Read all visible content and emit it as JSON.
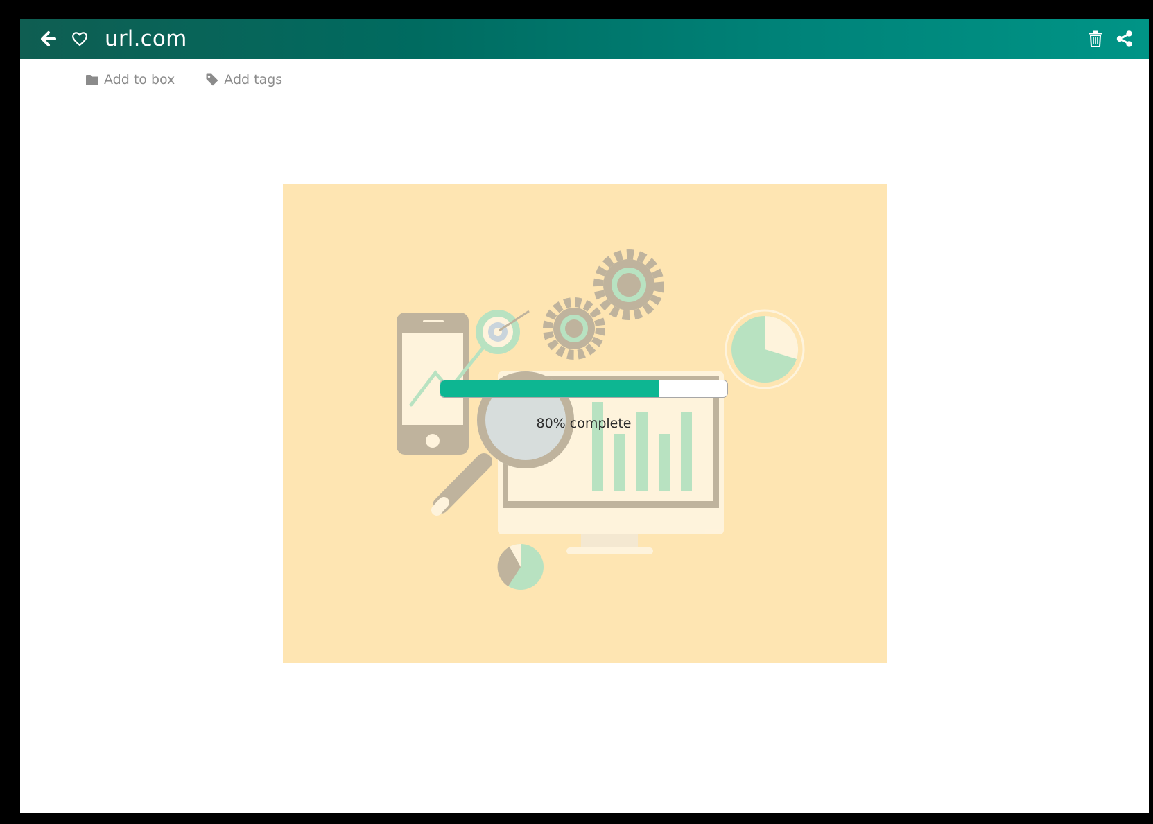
{
  "header": {
    "title": "url.com",
    "back_icon": "arrow-left-icon",
    "favorite_icon": "heart-outline-icon",
    "delete_icon": "trash-icon",
    "share_icon": "share-icon",
    "background_gradient": [
      "#0f5e52",
      "#009486"
    ]
  },
  "actions": {
    "add_to_box": {
      "label": "Add to box",
      "icon": "folder-icon"
    },
    "add_tags": {
      "label": "Add tags",
      "icon": "tag-icon"
    }
  },
  "preview": {
    "background_color": "#fee5b2",
    "illustration": "analytics-illustration"
  },
  "progress": {
    "percent": 80,
    "label": "80% complete",
    "fill_color": "#0db692"
  }
}
